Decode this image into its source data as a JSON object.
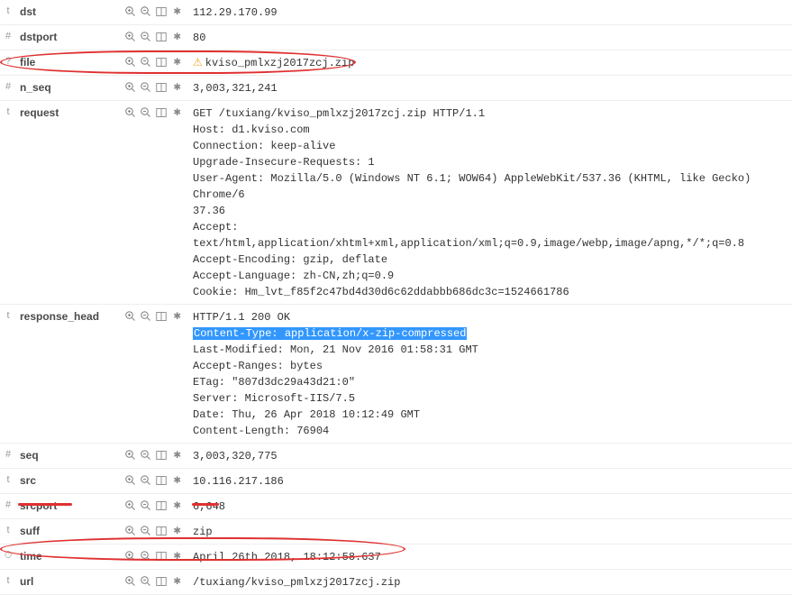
{
  "rows": [
    {
      "type": "t",
      "name": "dst",
      "value": "112.29.170.99",
      "warn": false
    },
    {
      "type": "#",
      "name": "dstport",
      "value": "80",
      "warn": false
    },
    {
      "type": "?",
      "name": "file",
      "value": "kviso_pmlxzj2017zcj.zip",
      "warn": true
    },
    {
      "type": "#",
      "name": "n_seq",
      "value": "3,003,321,241",
      "warn": false
    },
    {
      "type": "t",
      "name": "request",
      "value": "GET /tuxiang/kviso_pmlxzj2017zcj.zip HTTP/1.1\nHost: d1.kviso.com\nConnection: keep-alive\nUpgrade-Insecure-Requests: 1\nUser-Agent: Mozilla/5.0 (Windows NT 6.1; WOW64) AppleWebKit/537.36 (KHTML, like Gecko) Chrome/6\n37.36\nAccept: text/html,application/xhtml+xml,application/xml;q=0.9,image/webp,image/apng,*/*;q=0.8\nAccept-Encoding: gzip, deflate\nAccept-Language: zh-CN,zh;q=0.9\nCookie: Hm_lvt_f85f2c47bd4d30d6c62ddabbb686dc3c=1524661786",
      "warn": false
    },
    {
      "type": "t",
      "name": "response_head",
      "value_parts": [
        {
          "text": "HTTP/1.1 200 OK\n"
        },
        {
          "text": "Content-Type: application/x-zip-compressed",
          "hl": true
        },
        {
          "text": "\nLast-Modified: Mon, 21 Nov 2016 01:58:31 GMT\nAccept-Ranges: bytes\nETag: \"807d3dc29a43d21:0\"\nServer: Microsoft-IIS/7.5\nDate: Thu, 26 Apr 2018 10:12:49 GMT\nContent-Length: 76904"
        }
      ],
      "warn": false
    },
    {
      "type": "#",
      "name": "seq",
      "value": "3,003,320,775",
      "warn": false
    },
    {
      "type": "t",
      "name": "src",
      "value": "10.116.217.186",
      "warn": false
    },
    {
      "type": "#",
      "name": "srcport",
      "value": "6,648",
      "warn": false
    },
    {
      "type": "t",
      "name": "suff",
      "value": "zip",
      "warn": false
    },
    {
      "type": "⏱",
      "name": "time",
      "value": "April 26th 2018, 18:12:58.637",
      "warn": false
    },
    {
      "type": "t",
      "name": "url",
      "value": "/tuxiang/kviso_pmlxzj2017zcj.zip",
      "warn": false
    }
  ],
  "icon_titles": {
    "zoom_in": "Filter for value",
    "zoom_out": "Filter out value",
    "columns": "Toggle column",
    "exists": "Filter for field present"
  },
  "type_glyphs": {
    "t": "t",
    "#": "#",
    "?": "?",
    "⏱": "⏱"
  }
}
